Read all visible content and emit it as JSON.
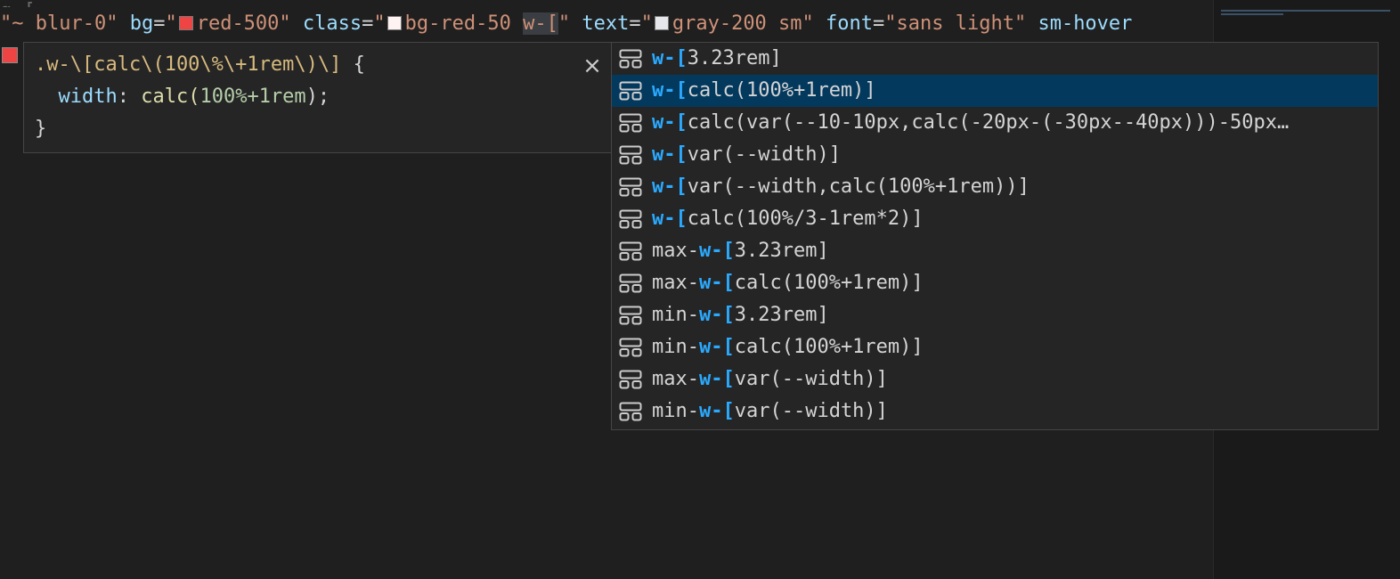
{
  "editor": {
    "top_partial_text": "  g     [",
    "code_line": [
      {
        "text": "\"~ blur-0\" ",
        "cls": "tok-str"
      },
      {
        "text": "bg",
        "cls": "tok-attr"
      },
      {
        "text": "=",
        "cls": "tok-plain"
      },
      {
        "text": "\"",
        "cls": "tok-str"
      },
      {
        "swatch": "#ef4444"
      },
      {
        "text": "red-500\" ",
        "cls": "tok-str"
      },
      {
        "text": "class",
        "cls": "tok-attr"
      },
      {
        "text": "=",
        "cls": "tok-plain"
      },
      {
        "text": "\"",
        "cls": "tok-str"
      },
      {
        "swatch": "#fef2f2"
      },
      {
        "text": "bg-red-50 ",
        "cls": "tok-str"
      },
      {
        "text": "w-[",
        "cls": "tok-str",
        "selected": true
      },
      {
        "text": "\" ",
        "cls": "tok-str"
      },
      {
        "text": "text",
        "cls": "tok-attr"
      },
      {
        "text": "=",
        "cls": "tok-plain"
      },
      {
        "text": "\"",
        "cls": "tok-str"
      },
      {
        "swatch": "#e5e7eb"
      },
      {
        "text": "gray-200 sm\" ",
        "cls": "tok-str"
      },
      {
        "text": "font",
        "cls": "tok-attr"
      },
      {
        "text": "=",
        "cls": "tok-plain"
      },
      {
        "text": "\"sans light\" ",
        "cls": "tok-str"
      },
      {
        "text": "sm-hover",
        "cls": "tok-attr"
      }
    ],
    "gutter_color": "#ef4444"
  },
  "hover": {
    "selector": ".w-\\[calc\\(100\\%\\+1rem\\)\\]",
    "open_brace": " {",
    "property": "width",
    "colon": ": ",
    "fn_name": "calc",
    "fn_open": "(",
    "fn_args": "100%+1rem",
    "fn_close": ");",
    "close_brace": "}",
    "close_label": "×"
  },
  "suggestions": {
    "focused_index": 1,
    "items": [
      {
        "prefix": "",
        "match": "w-[",
        "rest": "3.23rem]"
      },
      {
        "prefix": "",
        "match": "w-[",
        "rest": "calc(100%+1rem)]"
      },
      {
        "prefix": "",
        "match": "w-[",
        "rest": "calc(var(--10-10px,calc(-20px-(-30px--40px)))-50px…"
      },
      {
        "prefix": "",
        "match": "w-[",
        "rest": "var(--width)]"
      },
      {
        "prefix": "",
        "match": "w-[",
        "rest": "var(--width,calc(100%+1rem))]"
      },
      {
        "prefix": "",
        "match": "w-[",
        "rest": "calc(100%/3-1rem*2)]"
      },
      {
        "prefix": "max-",
        "match": "w-[",
        "rest": "3.23rem]"
      },
      {
        "prefix": "max-",
        "match": "w-[",
        "rest": "calc(100%+1rem)]"
      },
      {
        "prefix": "min-",
        "match": "w-[",
        "rest": "3.23rem]"
      },
      {
        "prefix": "min-",
        "match": "w-[",
        "rest": "calc(100%+1rem)]"
      },
      {
        "prefix": "max-",
        "match": "w-[",
        "rest": "var(--width)]"
      },
      {
        "prefix": "min-",
        "match": "w-[",
        "rest": "var(--width)]"
      }
    ]
  }
}
